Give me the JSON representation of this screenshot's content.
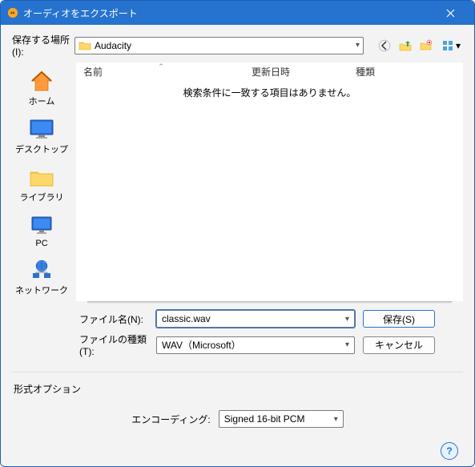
{
  "titlebar": {
    "title": "オーディオをエクスポート"
  },
  "location": {
    "label": "保存する場所(I):",
    "value": "Audacity"
  },
  "places": [
    {
      "key": "home",
      "label": "ホーム"
    },
    {
      "key": "desktop",
      "label": "デスクトップ"
    },
    {
      "key": "library",
      "label": "ライブラリ"
    },
    {
      "key": "pc",
      "label": "PC"
    },
    {
      "key": "network",
      "label": "ネットワーク"
    }
  ],
  "columns": {
    "name": "名前",
    "date": "更新日時",
    "type": "種類"
  },
  "empty_message": "検索条件に一致する項目はありません。",
  "filename": {
    "label": "ファイル名(N):",
    "value": "classic.wav"
  },
  "filetype": {
    "label": "ファイルの種類(T):",
    "value": "WAV（Microsoft）"
  },
  "buttons": {
    "save": "保存(S)",
    "cancel": "キャンセル"
  },
  "options_label": "形式オプション",
  "encoding": {
    "label": "エンコーディング:",
    "value": "Signed 16-bit PCM"
  }
}
